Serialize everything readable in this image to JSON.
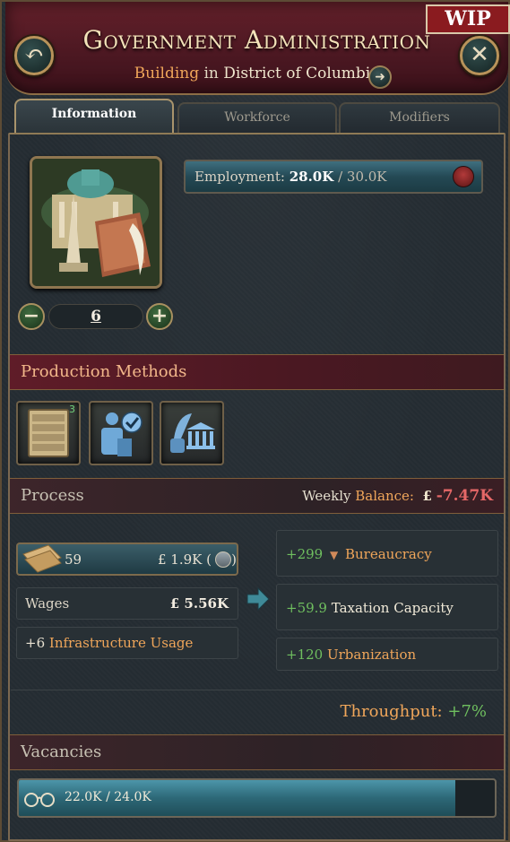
{
  "header": {
    "title": "Government Administration",
    "subtitle_type": "Building",
    "subtitle_in": "in",
    "subtitle_location": "District of Columbia",
    "back_icon": "↶",
    "close_icon": "✕",
    "goto_icon": "➜",
    "wip_label": "WIP"
  },
  "tabs": [
    {
      "label": "Information",
      "active": true
    },
    {
      "label": "Workforce",
      "active": false
    },
    {
      "label": "Modifiers",
      "active": false
    }
  ],
  "building": {
    "level": "6",
    "minus_label": "−",
    "plus_label": "+"
  },
  "employment": {
    "label": "Employment:",
    "current": "28.0K",
    "separator": "/",
    "max": "30.0K"
  },
  "production_methods": {
    "title": "Production Methods",
    "tiles": [
      {
        "icon": "file-cabinet-icon",
        "badge": "3"
      },
      {
        "icon": "clerk-checkmark-icon",
        "badge": ""
      },
      {
        "icon": "quill-government-icon",
        "badge": ""
      }
    ]
  },
  "process": {
    "title": "Process",
    "weekly_label": "Weekly",
    "balance_label": "Balance:",
    "balance_currency": "£",
    "balance_value": "-7.47K",
    "input": {
      "count": "59",
      "cost": "£ 1.9K",
      "open_paren": "(",
      "close_paren": ")"
    },
    "wages": {
      "label": "Wages",
      "value": "£ 5.56K"
    },
    "infrastructure": {
      "value": "+6",
      "label": "Infrastructure Usage"
    },
    "outputs": [
      {
        "value": "+299",
        "label": "Bureaucracy",
        "orange": true
      },
      {
        "value": "+59.9",
        "label": "Taxation Capacity",
        "orange": false
      },
      {
        "value": "+120",
        "label": "Urbanization",
        "orange": true
      }
    ],
    "throughput_label": "Throughput:",
    "throughput_value": "+7%"
  },
  "vacancies": {
    "title": "Vacancies",
    "text": "22.0K / 24.0K",
    "fill_fraction": 0.917
  },
  "colors": {
    "accent_orange": "#f0a65a",
    "positive_green": "#6fbf5f",
    "negative_red": "#e46767",
    "header_maroon": "#4b1822"
  }
}
